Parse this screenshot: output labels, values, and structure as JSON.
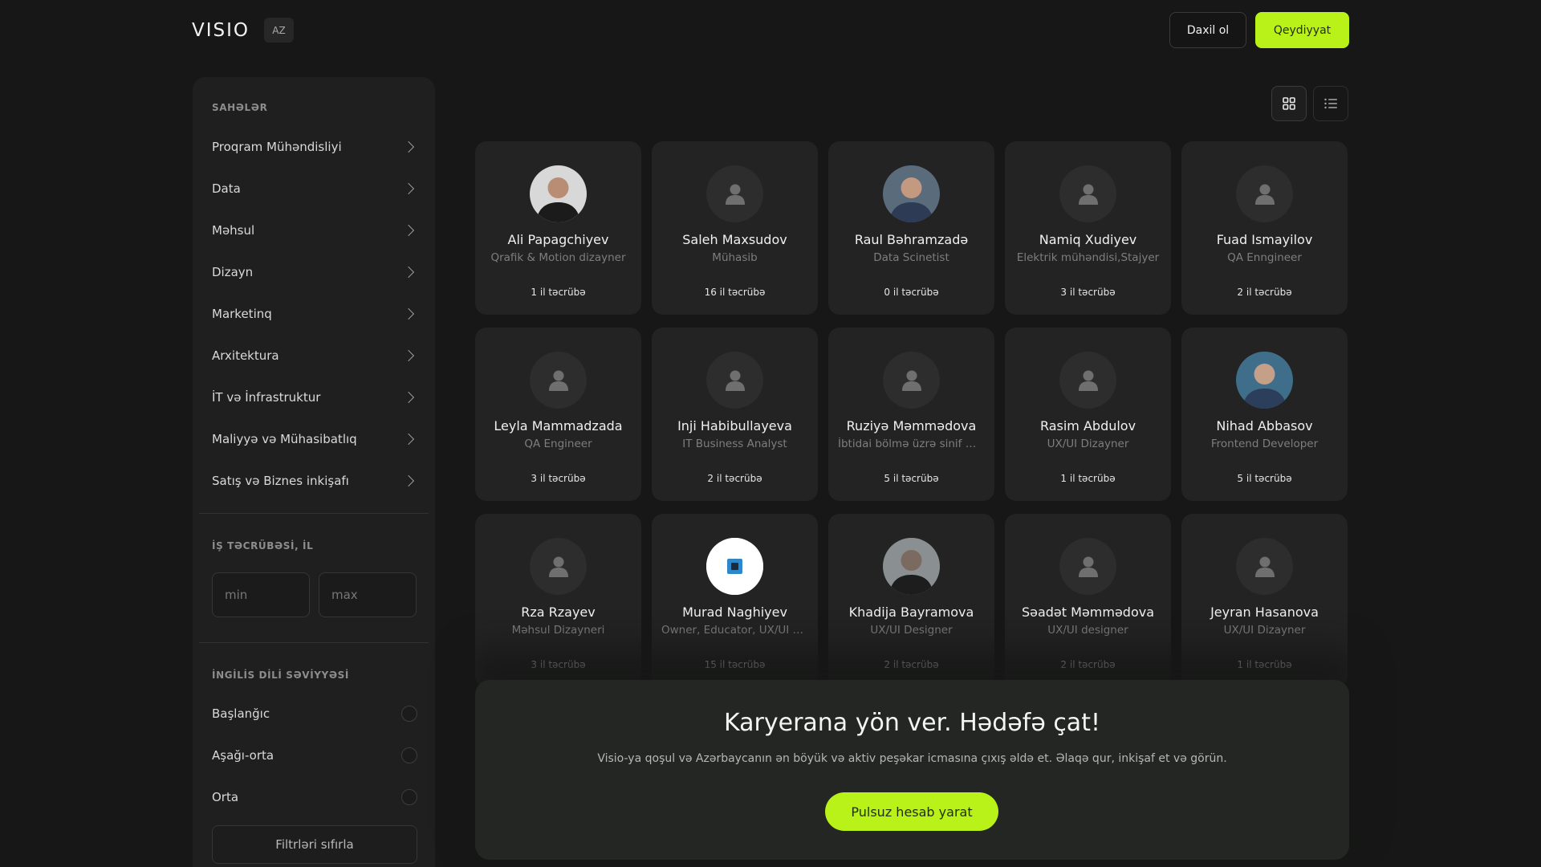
{
  "header": {
    "logo": "VISIO",
    "lang": "AZ",
    "login_label": "Daxil ol",
    "register_label": "Qeydiyyat"
  },
  "sidebar": {
    "fields_title": "SAHƏLƏR",
    "categories": [
      {
        "label": "Proqram Mühəndisliyi"
      },
      {
        "label": "Data"
      },
      {
        "label": "Məhsul"
      },
      {
        "label": "Dizayn"
      },
      {
        "label": "Marketinq"
      },
      {
        "label": "Arxitektura"
      },
      {
        "label": "İT və İnfrastruktur"
      },
      {
        "label": "Maliyyə və Mühasibatlıq"
      },
      {
        "label": "Satış və Biznes inkişafı"
      }
    ],
    "experience_title": "İŞ TƏCRÜBƏSİ, İL",
    "min_placeholder": "min",
    "max_placeholder": "max",
    "english_title": "İNGİLİS DİLİ SƏVİYYƏSİ",
    "english_levels": [
      {
        "label": "Başlanğıc"
      },
      {
        "label": "Aşağı-orta"
      },
      {
        "label": "Orta"
      }
    ],
    "reset_label": "Filtrləri sıfırla"
  },
  "view_toggle": {
    "grid_icon": "grid-icon",
    "list_icon": "list-icon",
    "active": "grid"
  },
  "profiles": [
    {
      "name": "Ali Papagchiyev",
      "role": "Qrafik & Motion dizayner",
      "exp": "1 il təcrübə",
      "avatar": "photo"
    },
    {
      "name": "Saleh Maxsudov",
      "role": "Mühasib",
      "exp": "16 il təcrübə",
      "avatar": "placeholder"
    },
    {
      "name": "Raul Bəhramzadə",
      "role": "Data Scinetist",
      "exp": "0 il təcrübə",
      "avatar": "photo"
    },
    {
      "name": "Namiq Xudiyev",
      "role": "Elektrik mühəndisi,Stajyer",
      "exp": "3 il təcrübə",
      "avatar": "placeholder"
    },
    {
      "name": "Fuad Ismayilov",
      "role": "QA Enngineer",
      "exp": "2 il təcrübə",
      "avatar": "placeholder"
    },
    {
      "name": "Leyla Mammadzada",
      "role": "QA Engineer",
      "exp": "3 il təcrübə",
      "avatar": "placeholder"
    },
    {
      "name": "Inji Habibullayeva",
      "role": "IT Business Analyst",
      "exp": "2 il təcrübə",
      "avatar": "placeholder"
    },
    {
      "name": "Ruziyə Məmmədova",
      "role": "İbtidai bölmə üzrə sinif müəllimi",
      "exp": "5 il təcrübə",
      "avatar": "placeholder"
    },
    {
      "name": "Rasim Abdulov",
      "role": "UX/UI Dizayner",
      "exp": "1 il təcrübə",
      "avatar": "placeholder"
    },
    {
      "name": "Nihad Abbasov",
      "role": "Frontend Developer",
      "exp": "5 il təcrübə",
      "avatar": "photo"
    },
    {
      "name": "Rza Rzayev",
      "role": "Məhsul Dizayneri",
      "exp": "3 il təcrübə",
      "avatar": "placeholder"
    },
    {
      "name": "Murad Naghiyev",
      "role": "Owner, Educator, UX/UI Designer",
      "exp": "15 il təcrübə",
      "avatar": "logo"
    },
    {
      "name": "Khadija Bayramova",
      "role": "UX/UI Designer",
      "exp": "2 il təcrübə",
      "avatar": "photo"
    },
    {
      "name": "Səadət Məmmədova",
      "role": "UX/UI designer",
      "exp": "2 il təcrübə",
      "avatar": "placeholder"
    },
    {
      "name": "Jeyran Hasanova",
      "role": "UX/UI Dizayner",
      "exp": "1 il təcrübə",
      "avatar": "placeholder"
    }
  ],
  "cta": {
    "title": "Karyerana yön ver. Hədəfə çat!",
    "text": "Visio-ya qoşul və Azərbaycanın ən böyük və aktiv peşəkar icmasına çıxış əldə et. Əlaqə qur, inkişaf et və görün.",
    "button_label": "Pulsuz hesab yarat"
  },
  "colors": {
    "background": "#161716",
    "panel": "#1e1f1e",
    "card": "#222322",
    "accent": "#b9f218"
  }
}
